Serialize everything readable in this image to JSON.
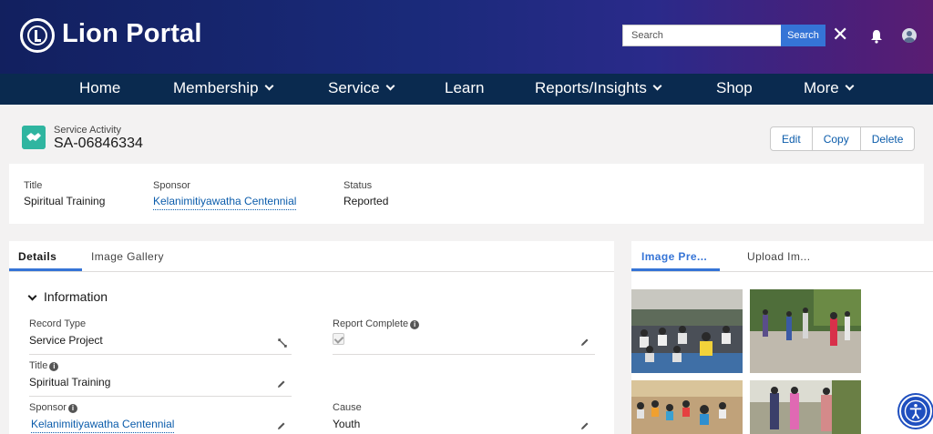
{
  "header": {
    "brand": "Lion Portal",
    "search_placeholder": "Search",
    "search_button": "Search",
    "close_glyph": "✕",
    "icons": [
      "lions-logo-icon",
      "close-icon",
      "bell-icon",
      "user-avatar-icon"
    ]
  },
  "nav": {
    "items": [
      {
        "label": "Home",
        "has_dropdown": false
      },
      {
        "label": "Membership",
        "has_dropdown": true
      },
      {
        "label": "Service",
        "has_dropdown": true
      },
      {
        "label": "Learn",
        "has_dropdown": false
      },
      {
        "label": "Reports/Insights",
        "has_dropdown": true
      },
      {
        "label": "Shop",
        "has_dropdown": false
      },
      {
        "label": "More",
        "has_dropdown": true
      }
    ]
  },
  "record": {
    "object_type": "Service Activity",
    "name": "SA-06846334",
    "actions": [
      "Edit",
      "Copy",
      "Delete"
    ]
  },
  "highlights": {
    "title_label": "Title",
    "title_value": "Spiritual Training",
    "sponsor_label": "Sponsor",
    "sponsor_value": "Kelanimitiyawatha Centennial",
    "status_label": "Status",
    "status_value": "Reported"
  },
  "details": {
    "tabs": [
      "Details",
      "Image Gallery"
    ],
    "section_title": "Information",
    "fields": {
      "record_type_label": "Record Type",
      "record_type_value": "Service Project",
      "report_complete_label": "Report Complete",
      "report_complete_value": true,
      "title_label": "Title",
      "title_value": "Spiritual Training",
      "sponsor_label": "Sponsor",
      "sponsor_value": "Kelanimitiyawatha Centennial",
      "cause_label": "Cause",
      "cause_value": "Youth"
    }
  },
  "images": {
    "tabs": [
      "Image Pre...",
      "Upload Im..."
    ]
  },
  "colors": {
    "header_start": "#12205f",
    "header_end": "#5a1d72",
    "nav_bg": "#0a2a4f",
    "accent": "#3574d6",
    "link": "#0b5cab",
    "record_icon": "#2fb5a0"
  }
}
